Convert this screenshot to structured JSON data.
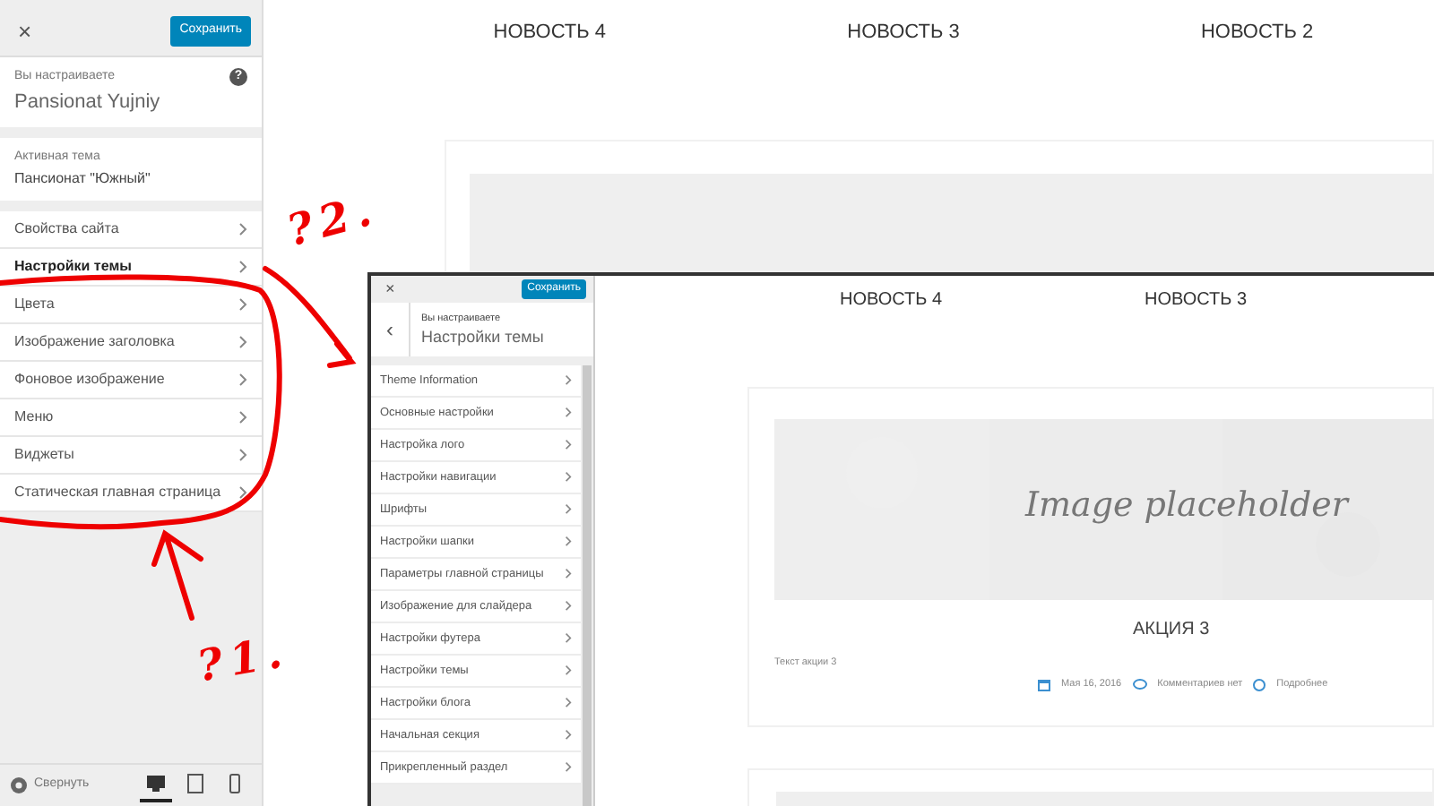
{
  "sidebar": {
    "close": "×",
    "save": "Сохранить",
    "customizing_label": "Вы настраиваете",
    "site_name": "Pansionat Yujniy",
    "help": "?",
    "theme_label": "Активная тема",
    "theme_name": "Пансионат \"Южный\"",
    "items": [
      {
        "label": "Свойства сайта",
        "highlighted": false
      },
      {
        "label": "Настройки темы",
        "highlighted": true
      },
      {
        "label": "Цвета",
        "highlighted": false
      },
      {
        "label": "Изображение заголовка",
        "highlighted": false
      },
      {
        "label": "Фоновое изображение",
        "highlighted": false
      },
      {
        "label": "Меню",
        "highlighted": false
      },
      {
        "label": "Виджеты",
        "highlighted": false
      },
      {
        "label": "Статическая главная страница",
        "highlighted": false
      }
    ],
    "collapse": "Свернуть",
    "devices": [
      {
        "kind": "desktop",
        "selected": true
      },
      {
        "kind": "tablet",
        "selected": false
      },
      {
        "kind": "mobile",
        "selected": false
      }
    ]
  },
  "preview": {
    "nav": [
      "НОВОСТЬ 4",
      "НОВОСТЬ 3",
      "НОВОСТЬ 2"
    ]
  },
  "inset": {
    "close": "×",
    "save": "Сохранить",
    "back": "‹",
    "customizing_label": "Вы настраиваете",
    "section": "Настройки темы",
    "items": [
      "Theme Information",
      "Основные настройки",
      "Настройка лого",
      "Настройки навигации",
      "Шрифты",
      "Настройки шапки",
      "Параметры главной страницы",
      "Изображение для слайдера",
      "Настройки футера",
      "Настройки темы",
      "Настройки блога",
      "Начальная секция",
      "Прикрепленный раздел"
    ],
    "nav": [
      "НОВОСТЬ 4",
      "НОВОСТЬ 3"
    ],
    "post": {
      "image_text": "Image placeholder",
      "title": "АКЦИЯ 3",
      "excerpt": "Текст акции 3",
      "date": "Мая 16, 2016",
      "comments": "Комментариев нет",
      "more": "Подробнее"
    }
  },
  "annotations": [
    {
      "text": "?2."
    },
    {
      "text": "?1."
    }
  ]
}
